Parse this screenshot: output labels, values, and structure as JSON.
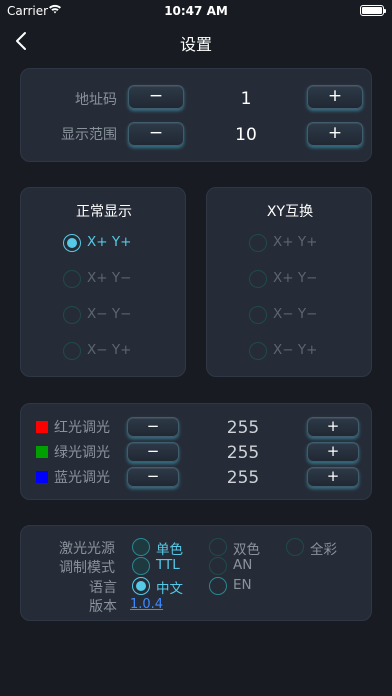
{
  "status_bar": {
    "carrier": "Carrier",
    "time": "10:47 AM"
  },
  "nav": {
    "title": "设置"
  },
  "address": {
    "label": "地址码",
    "value": "1",
    "minus": "−",
    "plus": "+"
  },
  "display_range": {
    "label": "显示范围",
    "value": "10",
    "minus": "−",
    "plus": "+"
  },
  "normal_display": {
    "title": "正常显示",
    "options": [
      "X+ Y+",
      "X+ Y−",
      "X− Y−",
      "X− Y+"
    ],
    "selected_index": 0
  },
  "xy_swap": {
    "title": "XY互换",
    "options": [
      "X+ Y+",
      "X+ Y−",
      "X− Y−",
      "X− Y+"
    ],
    "selected_index": -1
  },
  "dimming": [
    {
      "label": "红光调光",
      "value": "255",
      "color": "#ff0000",
      "minus": "−",
      "plus": "+"
    },
    {
      "label": "绿光调光",
      "value": "255",
      "color": "#00a000",
      "minus": "−",
      "plus": "+"
    },
    {
      "label": "蓝光调光",
      "value": "255",
      "color": "#0000ff",
      "minus": "−",
      "plus": "+"
    }
  ],
  "settings": {
    "laser_source": {
      "label": "激光光源",
      "options": [
        "单色",
        "双色",
        "全彩"
      ],
      "selected": "单色"
    },
    "modulation": {
      "label": "调制模式",
      "options": [
        "TTL",
        "AN"
      ],
      "selected": "TTL"
    },
    "language": {
      "label": "语言",
      "options": [
        "中文",
        "EN"
      ],
      "selected": "中文"
    },
    "version": {
      "label": "版本",
      "value": "1.0.4"
    }
  },
  "accent_color": "#56c9e6",
  "background_color": "#181c22"
}
